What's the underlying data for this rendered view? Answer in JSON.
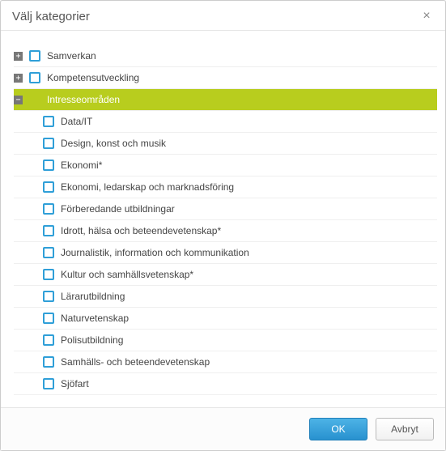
{
  "dialog": {
    "title": "Välj kategorier",
    "close_label": "×",
    "ok_label": "OK",
    "cancel_label": "Avbryt"
  },
  "tree": [
    {
      "level": 0,
      "label": "Samverkan",
      "expandable": true,
      "expanded": false,
      "checkbox": true,
      "checked": false,
      "selected": false
    },
    {
      "level": 0,
      "label": "Kompetensutveckling",
      "expandable": true,
      "expanded": false,
      "checkbox": true,
      "checked": false,
      "selected": false
    },
    {
      "level": 0,
      "label": "Intresseområden",
      "expandable": true,
      "expanded": true,
      "checkbox": false,
      "checked": false,
      "selected": true
    },
    {
      "level": 1,
      "label": "Data/IT",
      "expandable": false,
      "expanded": false,
      "checkbox": true,
      "checked": false,
      "selected": false
    },
    {
      "level": 1,
      "label": "Design, konst och musik",
      "expandable": false,
      "expanded": false,
      "checkbox": true,
      "checked": false,
      "selected": false
    },
    {
      "level": 1,
      "label": "Ekonomi*",
      "expandable": false,
      "expanded": false,
      "checkbox": true,
      "checked": false,
      "selected": false
    },
    {
      "level": 1,
      "label": "Ekonomi, ledarskap och marknadsföring",
      "expandable": false,
      "expanded": false,
      "checkbox": true,
      "checked": false,
      "selected": false
    },
    {
      "level": 1,
      "label": "Förberedande utbildningar",
      "expandable": false,
      "expanded": false,
      "checkbox": true,
      "checked": false,
      "selected": false
    },
    {
      "level": 1,
      "label": "Idrott, hälsa och beteendevetenskap*",
      "expandable": false,
      "expanded": false,
      "checkbox": true,
      "checked": false,
      "selected": false
    },
    {
      "level": 1,
      "label": "Journalistik, information och kommunikation",
      "expandable": false,
      "expanded": false,
      "checkbox": true,
      "checked": false,
      "selected": false
    },
    {
      "level": 1,
      "label": "Kultur och samhällsvetenskap*",
      "expandable": false,
      "expanded": false,
      "checkbox": true,
      "checked": false,
      "selected": false
    },
    {
      "level": 1,
      "label": "Lärarutbildning",
      "expandable": false,
      "expanded": false,
      "checkbox": true,
      "checked": false,
      "selected": false
    },
    {
      "level": 1,
      "label": "Naturvetenskap",
      "expandable": false,
      "expanded": false,
      "checkbox": true,
      "checked": false,
      "selected": false
    },
    {
      "level": 1,
      "label": "Polisutbildning",
      "expandable": false,
      "expanded": false,
      "checkbox": true,
      "checked": false,
      "selected": false
    },
    {
      "level": 1,
      "label": "Samhälls- och beteendevetenskap",
      "expandable": false,
      "expanded": false,
      "checkbox": true,
      "checked": false,
      "selected": false
    },
    {
      "level": 1,
      "label": "Sjöfart",
      "expandable": false,
      "expanded": false,
      "checkbox": true,
      "checked": false,
      "selected": false
    }
  ],
  "icons": {
    "expand": "+",
    "collapse": "−"
  }
}
